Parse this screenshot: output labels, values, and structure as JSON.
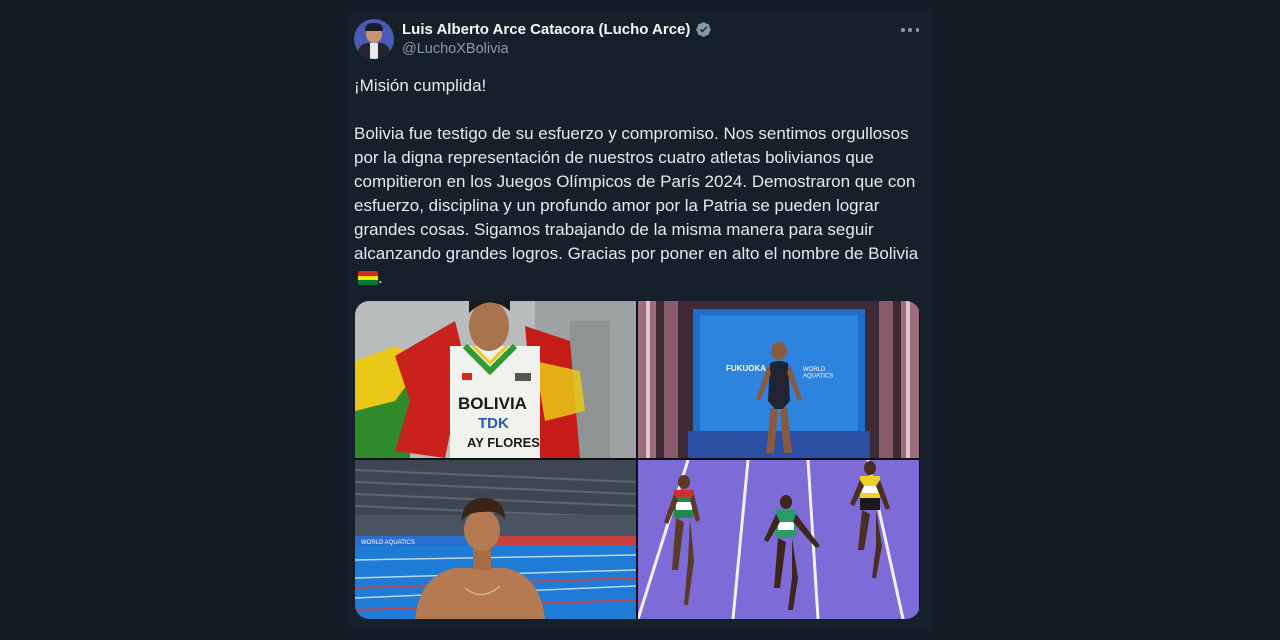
{
  "tweet": {
    "author": {
      "display_name": "Luis Alberto Arce Catacora (Lucho Arce)",
      "handle": "@LuchoXBolivia",
      "verified": true
    },
    "text": "¡Misión cumplida!\n\nBolivia fue testigo de su esfuerzo y compromiso. Nos sentimos orgullosos por la digna representación de nuestros cuatro atletas bolivianos que compitieron en los Juegos Olímpicos de París 2024. Demostraron que con esfuerzo, disciplina y un profundo amor por la Patria se pueden lograr grandes cosas. Sigamos trabajando de la misma manera para seguir alcanzando grandes logros. Gracias por poner en alto el nombre de Bolivia",
    "text_end": ".",
    "flag_emoji": "bolivia-flag-icon",
    "flag_colors": [
      "#d52b1e",
      "#f9e300",
      "#007934"
    ],
    "photos": {
      "runner": {
        "bib_country": "BOLIVIA",
        "bib_sponsor": "TDK",
        "bib_name": "AY FLORES"
      },
      "diver": {
        "backdrop_left": "FUKUOKA",
        "backdrop_right": "WORLD\nAQUATICS"
      },
      "swimmer": {
        "banner": "WORLD AQUATICS"
      }
    }
  },
  "colors": {
    "page_bg": "#141d26",
    "card_bg": "#16202b",
    "text_primary": "#e7e9ea",
    "text_secondary": "#8b98a5",
    "verified": "#829aab"
  }
}
